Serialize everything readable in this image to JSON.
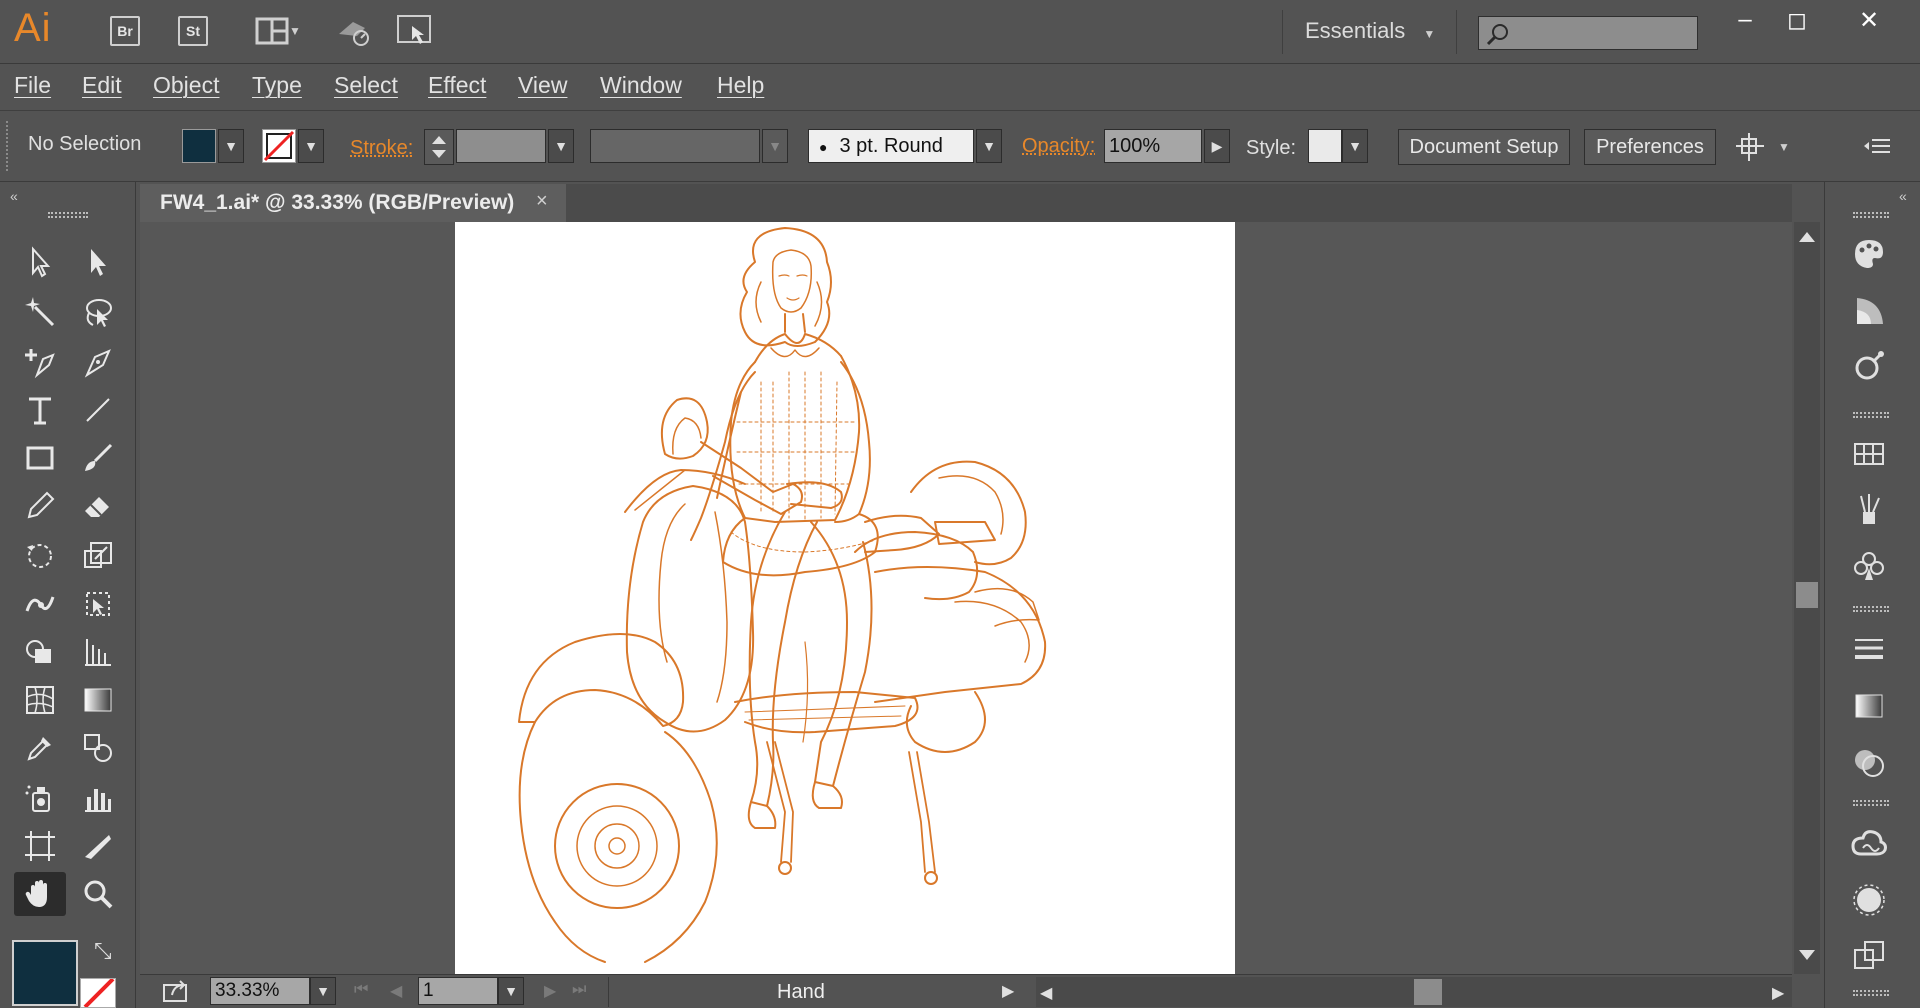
{
  "app": {
    "logo": "Ai",
    "bridge": "Br",
    "stock": "St"
  },
  "workspace": {
    "label": "Essentials"
  },
  "menu": [
    "File",
    "Edit",
    "Object",
    "Type",
    "Select",
    "Effect",
    "View",
    "Window",
    "Help"
  ],
  "control": {
    "selection": "No Selection",
    "stroke_label": "Stroke:",
    "brush": "3 pt. Round",
    "opacity_label": "Opacity:",
    "opacity_value": "100%",
    "style_label": "Style:",
    "document_setup": "Document Setup",
    "preferences": "Preferences"
  },
  "document": {
    "tab_title": "FW4_1.ai* @ 33.33% (RGB/Preview)",
    "close": "×"
  },
  "status": {
    "zoom": "33.33%",
    "page": "1",
    "tool": "Hand"
  },
  "colors": {
    "fill": "#0f2f3f",
    "accent": "#e8882a",
    "line_art": "#d9782a"
  },
  "window": {
    "minimize": "–",
    "maximize": "◻",
    "close": "✕"
  }
}
